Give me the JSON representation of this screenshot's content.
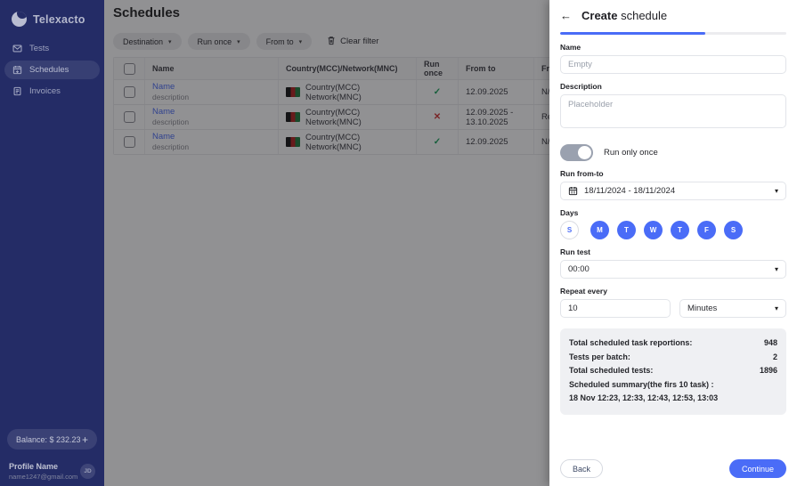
{
  "colors": {
    "accent": "#4a6cf7",
    "sidebar_bg": "#242c66",
    "success": "#18a05a",
    "danger": "#d23434"
  },
  "sidebar": {
    "logo_text": "Telexacto",
    "items": [
      {
        "label": "Tests"
      },
      {
        "label": "Schedules"
      },
      {
        "label": "Invoices"
      }
    ],
    "balance_label": "Balance: $ 232.23",
    "profile": {
      "name": "Profile Name",
      "email": "name1247@gmail.com",
      "avatar_initials": "JD"
    }
  },
  "main": {
    "title": "Schedules",
    "filters": {
      "destination_label": "Destination",
      "run_once_label": "Run once",
      "from_to_label": "From to",
      "clear_filter_label": "Clear filter"
    },
    "table": {
      "headers": {
        "name": "Name",
        "country": "Country(MCC)/Network(MNC)",
        "run_once": "Run once",
        "from_to": "From to",
        "frequency": "Freq"
      },
      "rows": [
        {
          "name": "Name",
          "description": "description",
          "country": "Country(MCC) Network(MNC)",
          "run_once_icon": "check",
          "from_to": "12.09.2025",
          "frequency": "N/A"
        },
        {
          "name": "Name",
          "description": "description",
          "country": "Country(MCC) Network(MNC)",
          "run_once_icon": "cross",
          "from_to": "12.09.2025 - 13.10.2025",
          "frequency": "Repe"
        },
        {
          "name": "Name",
          "description": "description",
          "country": "Country(MCC) Network(MNC)",
          "run_once_icon": "check",
          "from_to": "12.09.2025",
          "frequency": "N/A"
        }
      ]
    }
  },
  "drawer": {
    "title_bold": "Create",
    "title_regular": "schedule",
    "progress_percent": 64,
    "fields": {
      "name_label": "Name",
      "name_placeholder": "Empty",
      "description_label": "Description",
      "description_placeholder": "Placeholder",
      "run_only_once_label": "Run only once",
      "run_from_to_label": "Run from-to",
      "run_from_to_value": "18/11/2024 - 18/11/2024",
      "days_label": "Days",
      "run_test_label": "Run test",
      "run_test_value": "00:00",
      "repeat_every_label": "Repeat every",
      "repeat_every_value": "10",
      "repeat_unit_value": "Minutes"
    },
    "days": [
      {
        "label": "S",
        "selected": false
      },
      {
        "label": "M",
        "selected": true
      },
      {
        "label": "T",
        "selected": true
      },
      {
        "label": "W",
        "selected": true
      },
      {
        "label": "T",
        "selected": true
      },
      {
        "label": "F",
        "selected": true
      },
      {
        "label": "S",
        "selected": true
      }
    ],
    "summary": {
      "rows": [
        {
          "label": "Total scheduled task reportions:",
          "value": "948"
        },
        {
          "label": "Tests per batch:",
          "value": "2"
        },
        {
          "label": "Total scheduled tests:",
          "value": "1896"
        }
      ],
      "schedule_summary_label": "Scheduled summary(the firs 10 task) :",
      "schedule_summary_value": "18 Nov 12:23, 12:33, 12:43, 12:53, 13:03"
    },
    "back_label": "Back",
    "continue_label": "Continue"
  }
}
